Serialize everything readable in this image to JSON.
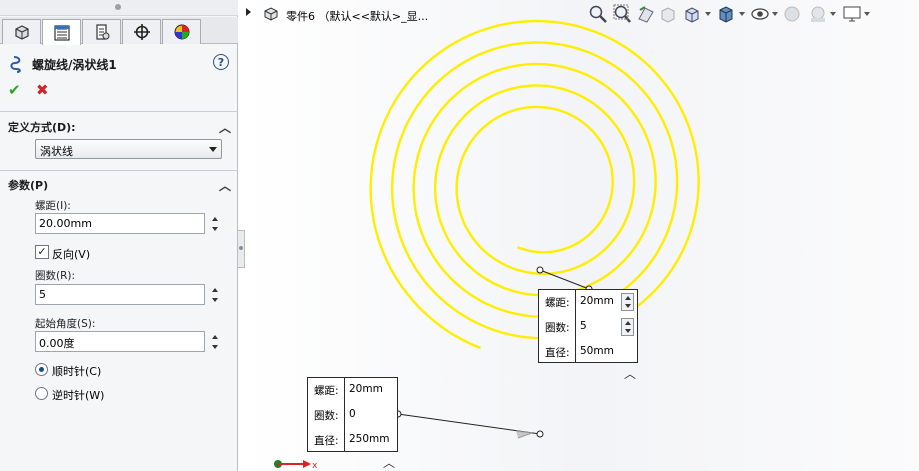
{
  "property_manager": {
    "tabs": [
      "feature-manager",
      "property-manager",
      "configuration-manager",
      "dimxpert-manager",
      "display-manager"
    ],
    "feature_title": "螺旋线/涡状线1",
    "help_label": "?",
    "ok_label": "✔",
    "cancel_label": "✖",
    "define_group": {
      "title": "定义方式(D):",
      "selected": "涡状线"
    },
    "params_group": {
      "title": "参数(P)",
      "pitch_label": "螺距(I):",
      "pitch_value": "20.00mm",
      "reverse_label": "反向(V)",
      "reverse_checked": true,
      "revolutions_label": "圈数(R):",
      "revolutions_value": "5",
      "start_angle_label": "起始角度(S):",
      "start_angle_value": "0.00度",
      "clockwise_label": "顺时针(C)",
      "counterclockwise_label": "逆时针(W)",
      "direction": "clockwise"
    }
  },
  "viewport": {
    "part_name": "零件6 （默认<<默认>_显...",
    "spiral_color": "#ffee00",
    "heads_up_icons": [
      "zoom-to-fit-icon",
      "zoom-to-area-icon",
      "previous-view-icon",
      "section-view-icon",
      "view-orientation-icon",
      "display-style-icon",
      "hide-show-items-icon",
      "edit-appearance-icon",
      "apply-scene-icon",
      "view-settings-icon"
    ],
    "callout_inner": {
      "pitch_label": "螺距:",
      "pitch_value": "20mm",
      "revolutions_label": "圈数:",
      "revolutions_value": "5",
      "diameter_label": "直径:",
      "diameter_value": "50mm"
    },
    "callout_outer": {
      "pitch_label": "螺距:",
      "pitch_value": "20mm",
      "revolutions_label": "圈数:",
      "revolutions_value": "0",
      "diameter_label": "直径:",
      "diameter_value": "250mm"
    }
  }
}
